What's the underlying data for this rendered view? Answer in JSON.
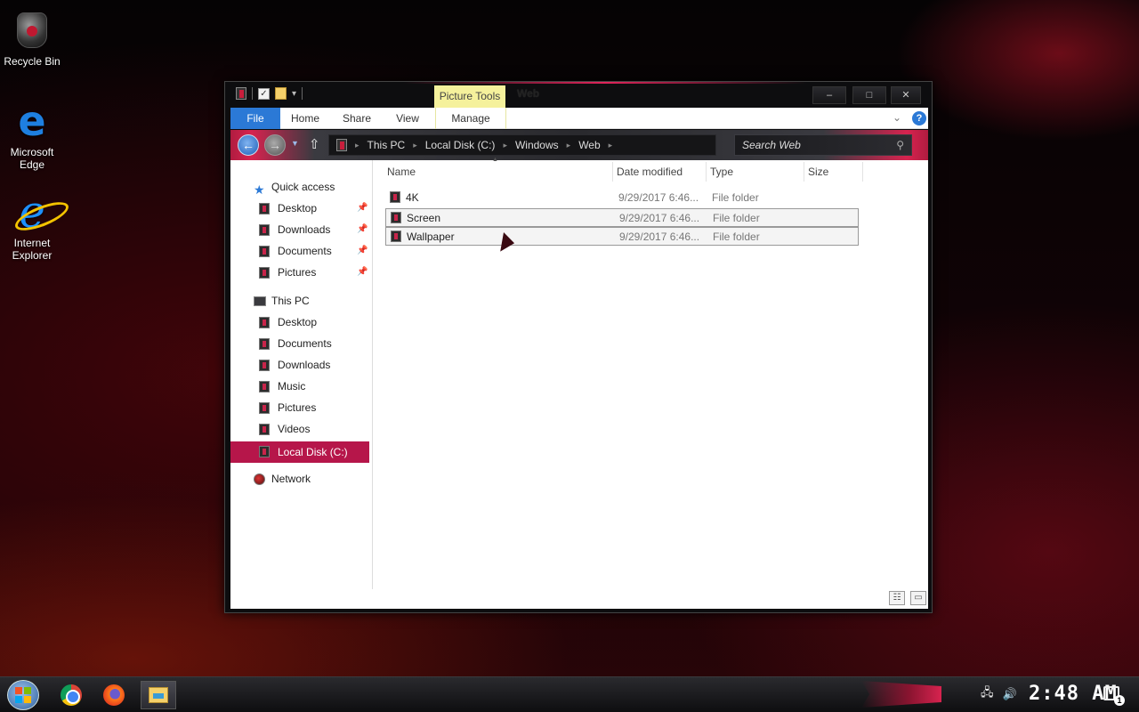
{
  "desktop": {
    "icons": [
      {
        "label": "Recycle Bin",
        "icon": "recycle-bin-icon"
      },
      {
        "label": "Microsoft Edge",
        "icon": "edge-icon"
      },
      {
        "label": "Internet Explorer",
        "icon": "internet-explorer-icon"
      }
    ]
  },
  "window": {
    "title": "Web",
    "context_tab": "Picture Tools",
    "controls": {
      "minimize": "–",
      "maximize": "□",
      "close": "✕"
    }
  },
  "ribbon": {
    "tabs": [
      "File",
      "Home",
      "Share",
      "View",
      "Manage"
    ],
    "help": "?"
  },
  "address_bar": {
    "crumbs": [
      "This PC",
      "Local Disk (C:)",
      "Windows",
      "Web"
    ],
    "search_placeholder": "Search Web"
  },
  "nav_pane": {
    "quick_access": {
      "label": "Quick access",
      "items": [
        "Desktop",
        "Downloads",
        "Documents",
        "Pictures"
      ]
    },
    "this_pc": {
      "label": "This PC",
      "items": [
        "Desktop",
        "Documents",
        "Downloads",
        "Music",
        "Pictures",
        "Videos",
        "Local Disk (C:)"
      ],
      "selected": "Local Disk (C:)"
    },
    "network": {
      "label": "Network"
    }
  },
  "file_list": {
    "columns": [
      "Name",
      "Date modified",
      "Type",
      "Size"
    ],
    "rows": [
      {
        "name": "4K",
        "date": "9/29/2017 6:46...",
        "type": "File folder",
        "size": ""
      },
      {
        "name": "Screen",
        "date": "9/29/2017 6:46...",
        "type": "File folder",
        "size": ""
      },
      {
        "name": "Wallpaper",
        "date": "9/29/2017 6:46...",
        "type": "File folder",
        "size": ""
      }
    ]
  },
  "taskbar": {
    "apps": [
      "start-button",
      "chrome-icon",
      "firefox-icon",
      "file-explorer-icon"
    ],
    "clock": "2:48 AM",
    "notification_count": "1"
  },
  "colors": {
    "accent": "#b6164a",
    "ribbon_file": "#2b79d6",
    "context_tab": "#f5f19c"
  }
}
